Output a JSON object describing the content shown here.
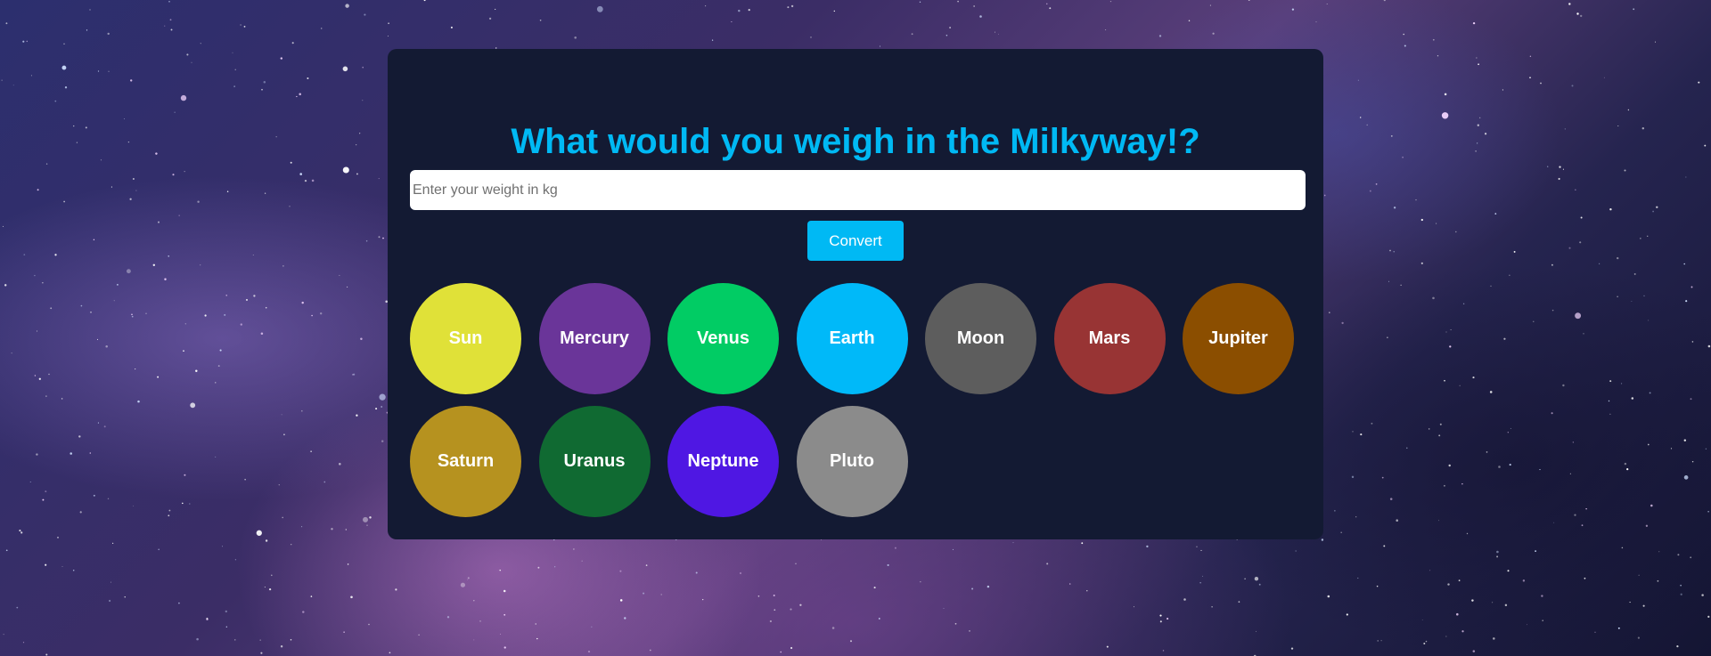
{
  "page": {
    "title": "What would you weigh in the Milkyway!?"
  },
  "form": {
    "weight_placeholder": "Enter your weight in kg",
    "weight_value": "",
    "convert_label": "Convert"
  },
  "planets": [
    {
      "name": "Sun",
      "color": "#e0e138"
    },
    {
      "name": "Mercury",
      "color": "#6a3599"
    },
    {
      "name": "Venus",
      "color": "#01cc64"
    },
    {
      "name": "Earth",
      "color": "#00b9f9"
    },
    {
      "name": "Moon",
      "color": "#5d5d5d"
    },
    {
      "name": "Mars",
      "color": "#983434"
    },
    {
      "name": "Jupiter",
      "color": "#8b4e00"
    },
    {
      "name": "Saturn",
      "color": "#b6921f"
    },
    {
      "name": "Uranus",
      "color": "#106a32"
    },
    {
      "name": "Neptune",
      "color": "#4f17e3"
    },
    {
      "name": "Pluto",
      "color": "#8b8b8b"
    }
  ],
  "colors": {
    "accent": "#00b9f4",
    "card_background": "#131a33"
  }
}
